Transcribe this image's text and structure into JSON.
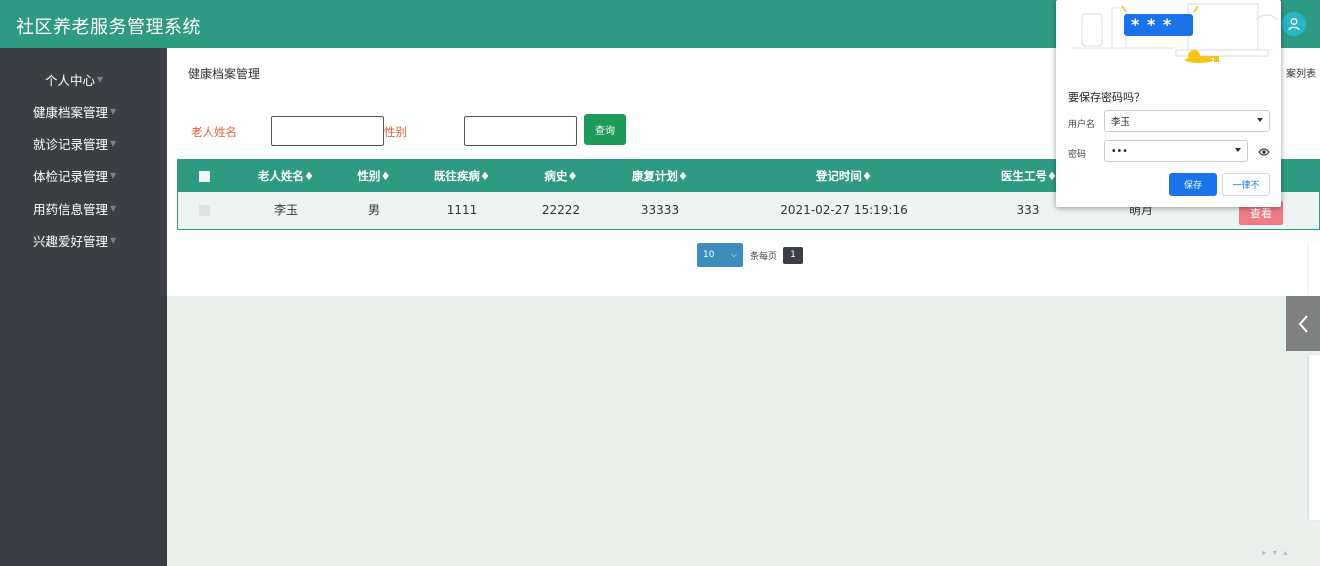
{
  "app": {
    "title": "社区养老服务管理系统"
  },
  "sidebar": {
    "items": [
      {
        "label": "个人中心"
      },
      {
        "label": "健康档案管理"
      },
      {
        "label": "就诊记录管理"
      },
      {
        "label": "体检记录管理"
      },
      {
        "label": "用药信息管理"
      },
      {
        "label": "兴趣爱好管理"
      }
    ]
  },
  "page": {
    "title": "健康档案管理",
    "list_link": "案列表"
  },
  "filters": {
    "name_label": "老人姓名",
    "gender_label": "性别",
    "name_value": "",
    "gender_value": "",
    "query_label": "查询"
  },
  "table": {
    "columns": [
      "老人姓名",
      "性别",
      "既往疾病",
      "病史",
      "康复计划",
      "登记时间",
      "医生工号"
    ],
    "sort_glyph": "♦",
    "rows": [
      {
        "name": "李玉",
        "gender": "男",
        "past_disease": "1111",
        "history": "22222",
        "plan": "33333",
        "time": "2021-02-27 15:19:16",
        "doctor_id": "333",
        "extra": "萌月",
        "action": "查看"
      }
    ]
  },
  "pager": {
    "page_size": "10",
    "per_page_label": "条每页",
    "current_page": "1"
  },
  "password_popup": {
    "stars": "* * *",
    "title": "要保存密码吗？",
    "username_label": "用户名",
    "username_value": "李玉",
    "password_label": "密码",
    "password_value": "•••",
    "save_label": "保存",
    "never_label": "一律不"
  },
  "colors": {
    "header": "#2f9a83",
    "sidebar": "#3b3f44",
    "query_button": "#1e9b5a",
    "view_button": "#ee7b86",
    "filter_label": "#e5623c",
    "save_button": "#1a73e8"
  }
}
